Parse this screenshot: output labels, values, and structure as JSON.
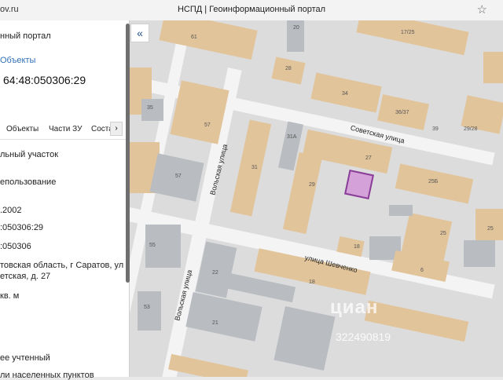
{
  "browser": {
    "url": "ov.ru",
    "title": "НСПД | Геоинформационный портал"
  },
  "panel": {
    "portal": "нный портал",
    "objects_link": "Объекты",
    "cadastral_number": "64:48:050306:29",
    "tabs": [
      "Объекты",
      "Части ЗУ",
      "Соста"
    ],
    "tab_arrow": "›",
    "lines": [
      "льный участок",
      "епользование",
      ".2002",
      ":050306:29",
      ":050306",
      "товская область, г Саратов, ул",
      "етская, д. 27",
      "кв. м",
      "ее учтенный",
      "ли населенных пунктов"
    ]
  },
  "map": {
    "collapse_icon": "«",
    "streets": [
      "Советская улица",
      "улица Шевченко",
      "Вольская улица",
      "Вольская улица"
    ],
    "labels": [
      "61",
      "20",
      "17/25",
      "28",
      "34",
      "36/37",
      "35",
      "57",
      "31А",
      "39",
      "29/28",
      "31",
      "27",
      "25Б",
      "29",
      "57",
      "18",
      "25",
      "55",
      "22",
      "6",
      "53",
      "21",
      "18",
      "25"
    ],
    "watermark": "циан",
    "watermark_id": "322490819"
  }
}
